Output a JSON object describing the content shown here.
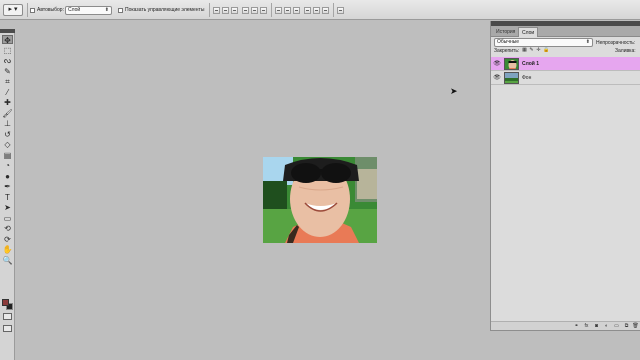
{
  "options_bar": {
    "tool_preset": "▸ ▾",
    "auto_select_label": "Автовыбор:",
    "auto_select_target": "Слой",
    "show_transform_label": "Показать управляющие элементы"
  },
  "toolbox": {
    "tools": [
      {
        "name": "move-tool",
        "glyph": "✥",
        "active": true
      },
      {
        "name": "marquee-tool",
        "glyph": "⬚"
      },
      {
        "name": "lasso-tool",
        "glyph": "ᔓ"
      },
      {
        "name": "quick-select-tool",
        "glyph": "✎"
      },
      {
        "name": "crop-tool",
        "glyph": "⌗"
      },
      {
        "name": "eyedropper-tool",
        "glyph": "⁄"
      },
      {
        "name": "healing-brush-tool",
        "glyph": "✚"
      },
      {
        "name": "brush-tool",
        "glyph": "🖌"
      },
      {
        "name": "clone-stamp-tool",
        "glyph": "⊥"
      },
      {
        "name": "history-brush-tool",
        "glyph": "↺"
      },
      {
        "name": "eraser-tool",
        "glyph": "◇"
      },
      {
        "name": "gradient-tool",
        "glyph": "▤"
      },
      {
        "name": "blur-tool",
        "glyph": "◔"
      },
      {
        "name": "dodge-tool",
        "glyph": "●"
      },
      {
        "name": "pen-tool",
        "glyph": "✒"
      },
      {
        "name": "type-tool",
        "glyph": "T"
      },
      {
        "name": "path-select-tool",
        "glyph": "➤"
      },
      {
        "name": "shape-tool",
        "glyph": "▭"
      },
      {
        "name": "3d-rotate-tool",
        "glyph": "⟲"
      },
      {
        "name": "3d-camera-tool",
        "glyph": "⟳"
      },
      {
        "name": "hand-tool",
        "glyph": "✋"
      },
      {
        "name": "zoom-tool",
        "glyph": "🔍"
      }
    ],
    "foreground_color": "#8b3a3a",
    "background_color": "#222222"
  },
  "layers_panel": {
    "tabs": [
      {
        "label": "История",
        "active": false
      },
      {
        "label": "Слои",
        "active": true
      }
    ],
    "blend_mode": "Обычные",
    "opacity_label": "Непрозрачность:",
    "lock_label": "Закрепить:",
    "fill_label": "Заливка:",
    "layers": [
      {
        "name": "Слой 1",
        "selected": true
      },
      {
        "name": "Фон",
        "selected": false
      }
    ]
  },
  "colors": {
    "selection": "#e6a6ef",
    "canvas_bg": "#bebebe"
  }
}
